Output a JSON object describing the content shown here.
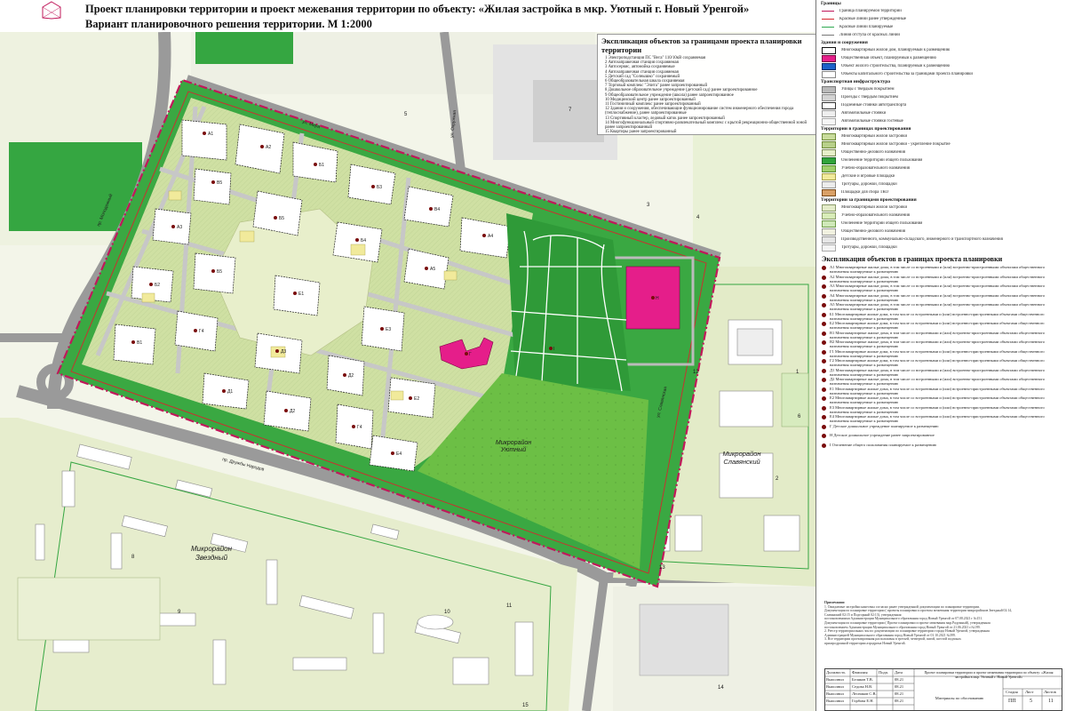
{
  "header": {
    "title_line1": "Проект планировки территории и проект межевания территории по объекту:  «Жилая застройка в мкр. Уютный г. Новый Уренгой»",
    "title_line2": "Вариант планировочного решения территории. М 1:2000"
  },
  "map": {
    "district_labels": {
      "uyutny": "Микрорайон\nУютный",
      "zvezdny": "Микрорайон\nЗвездный",
      "slavyansky": "Микрорайон\nСлавянский"
    },
    "street_labels": {
      "mira": "ул. Мира",
      "druzhby": "пр. Дружбы Народов",
      "stepan": "пр. Молодежный",
      "okruzhnaya": "ул. Окружная",
      "slavyanskaya": "ул. Славянская"
    },
    "building_codes": [
      "А1",
      "А2",
      "А3",
      "А4",
      "А5",
      "Б1",
      "Б2",
      "Б3",
      "Б4",
      "Б5",
      "В1",
      "В2",
      "В3",
      "В4",
      "В5",
      "Г1",
      "Г2",
      "Г3",
      "Г4",
      "Г5",
      "Д1",
      "Д2",
      "Д3",
      "Д4",
      "Е1",
      "Е2",
      "Е3",
      "Е4"
    ],
    "site_numbers": [
      "1",
      "2",
      "3",
      "4",
      "5",
      "6",
      "7",
      "8",
      "9",
      "10",
      "11",
      "12",
      "13",
      "14",
      "15"
    ]
  },
  "explication_outside": {
    "title": "Экспликация объектов за границами проекта планировки территории",
    "items": [
      "1 Электроподстанция ПС \"Вега\" 110/10кВ сохраняемая",
      "2 Автозаправочная станция сохраняемая",
      "3 Автосервис, автомойка сохраняемые",
      "4 Автозаправочная станция сохраняемая",
      "5 Детский сад \"Солнышко\" сохраняемый",
      "6 Общеобразовательная школа сохраняемая",
      "7 Торговый комплекс \"Элита\" ранее запроектированный",
      "8 Дошкольное образовательное учреждение (детский сад) ранее запроектированное",
      "9 Общеобразовательное учреждение (школа) ранее запроектированное",
      "10 Медицинский центр ранее запроектированный",
      "11 Гостиничный комплекс ранее запроектированный",
      "12 Здания и сооружения, обеспечивающие функционирование систем инженерного обеспечения города (теплоснабжение), ранее запроектированные",
      "13 Спортивный кластер, ледовый каток ранее запроектированный",
      "14 Многофункциональный спортивно-развлекательный комплекс с крытой рекреационно-общественной зоной ранее запроектированный",
      "15 Квартиры ранее запроектированный"
    ]
  },
  "legend": {
    "sections": [
      {
        "title": "Границы",
        "rows": [
          {
            "label": "Граница планируемой территории",
            "color": "#ffffff",
            "border": "#c0185a"
          },
          {
            "label": "Красные линии ранее утвержденные",
            "color": "#ffffff",
            "border": "#d6262e"
          },
          {
            "label": "Красные линии планируемые",
            "color": "#ffffff",
            "border": "#2fa84f"
          },
          {
            "label": "Линия отступа от красных линий",
            "color": "#ffffff",
            "border": "#777777"
          }
        ]
      },
      {
        "title": "Здания и сооружения",
        "rows": [
          {
            "label": "Многоквартирный жилой дом, планируемый к размещению",
            "color": "#ffffff",
            "border": "#111111"
          },
          {
            "label": "Общественный объект, планируемый к размещению",
            "color": "#e51e8a",
            "border": "#7a0040"
          },
          {
            "label": "Объект жилого строительства, планируемый к размещению",
            "color": "#1e62c9",
            "border": "#0a2a66"
          },
          {
            "label": "Объекты капитального строительства за границами проекта планировки",
            "color": "#ffffff",
            "border": "#888888"
          }
        ]
      },
      {
        "title": "Транспортная инфраструктура",
        "rows": [
          {
            "label": "Улицы с твердым покрытием",
            "color": "#b9b9b9",
            "border": "#777777"
          },
          {
            "label": "Проезды с твердым покрытием",
            "color": "#d3d3d3",
            "border": "#888888"
          },
          {
            "label": "Подземные стоянки автотранспорта",
            "color": "#ffffff",
            "border": "#333333"
          },
          {
            "label": "Автомобильные стоянки",
            "color": "#eeeeee",
            "border": "#999999"
          },
          {
            "label": "Автомобильные стоянки гостевые",
            "color": "#f6f6f6",
            "border": "#aaaaaa"
          }
        ]
      },
      {
        "title": "Территории в границах проектирования",
        "rows": [
          {
            "label": "Многоквартирный жилой застройки",
            "color": "#c9dc9c",
            "border": "#6e8a3a"
          },
          {
            "label": "Многоквартирный жилой застройки - укрепление покрытие",
            "color": "#b8d08a",
            "border": "#6e8a3a"
          },
          {
            "label": "Общественно-делового назначения",
            "color": "#e7efc9",
            "border": "#7e8a5a"
          },
          {
            "label": "Озеленение территорий общего пользования",
            "color": "#2fa33a",
            "border": "#1f6a25"
          },
          {
            "label": "Учебно-образовательного назначения",
            "color": "#9fcf6b",
            "border": "#5a8a33"
          },
          {
            "label": "Детские и игровые площадки",
            "color": "#f1ea9b",
            "border": "#a7a04a"
          },
          {
            "label": "Тротуары, дорожки, площадки",
            "color": "#ececec",
            "border": "#999999"
          },
          {
            "label": "Площадки для сбора ТКО",
            "color": "#d9a066",
            "border": "#7a4a1a"
          }
        ]
      },
      {
        "title": "Территории за границами проектирования",
        "rows": [
          {
            "label": "Многоквартирный жилой застройки",
            "color": "#e4ecc9",
            "border": "#8a9a6a"
          },
          {
            "label": "Учебно-образовательного назначения",
            "color": "#d8ecb8",
            "border": "#8a9a6a"
          },
          {
            "label": "Озеленение территорий общего пользования",
            "color": "#cfe8b8",
            "border": "#6f9a4a"
          },
          {
            "label": "Общественно-делового назначения",
            "color": "#f1f1e0",
            "border": "#999999"
          },
          {
            "label": "Производственного, коммунально-складского, инженерного и транспортного назначения",
            "color": "#e6e6e6",
            "border": "#999999"
          },
          {
            "label": "Тротуары, дорожки, площадки",
            "color": "#f4f4f4",
            "border": "#aaaaaa"
          }
        ]
      }
    ]
  },
  "explication_inside": {
    "title": "Экспликация объектов в границах проекта планировки",
    "items": [
      "А1 Многоквартирные жилые дома, в том числе со встроенными и (или) встроенно-пристроенными объектами общественного назначения планируемые к размещению",
      "А2 Многоквартирные жилые дома, в том числе со встроенными и (или) встроенно-пристроенными объектами общественного назначения планируемые к размещению",
      "А3 Многоквартирные жилые дома, в том числе со встроенными и (или) встроенно-пристроенными объектами общественного назначения планируемые к размещению",
      "А4 Многоквартирные жилые дома, в том числе со встроенными и (или) встроенно-пристроенными объектами общественного назначения планируемые к размещению",
      "А5 Многоквартирные жилые дома, в том числе со встроенными и (или) встроенно-пристроенными объектами общественного назначения планируемые к размещению",
      "Б1 Многоквартирные жилые дома, в том числе со встроенными и (или) встроенно-пристроенными объектами общественного назначения планируемые к размещению",
      "Б2 Многоквартирные жилые дома, в том числе со встроенными и (или) встроенно-пристроенными объектами общественного назначения планируемые к размещению",
      "В1 Многоквартирные жилые дома, в том числе со встроенными и (или) встроенно-пристроенными объектами общественного назначения планируемые к размещению",
      "В2 Многоквартирные жилые дома, в том числе со встроенными и (или) встроенно-пристроенными объектами общественного назначения планируемые к размещению",
      "Г1 Многоквартирные жилые дома, в том числе со встроенными и (или) встроенно-пристроенными объектами общественного назначения планируемые к размещению",
      "Г2 Многоквартирные жилые дома, в том числе со встроенными и (или) встроенно-пристроенными объектами общественного назначения планируемые к размещению",
      "Д1 Многоквартирные жилые дома, в том числе со встроенными и (или) встроенно-пристроенными объектами общественного назначения планируемые к размещению",
      "Д2 Многоквартирные жилые дома, в том числе со встроенными и (или) встроенно-пристроенными объектами общественного назначения планируемые к размещению",
      "Е1 Многоквартирные жилые дома, в том числе со встроенными и (или) встроенно-пристроенными объектами общественного назначения планируемые к размещению",
      "Е2 Многоквартирные жилые дома, в том числе со встроенными и (или) встроенно-пристроенными объектами общественного назначения планируемые к размещению",
      "Е3 Многоквартирные жилые дома, в том числе со встроенными и (или) встроенно-пристроенными объектами общественного назначения планируемые к размещению",
      "Е4 Многоквартирные жилые дома, в том числе со встроенными и (или) встроенно-пристроенными объектами общественного назначения планируемые к размещению",
      "Г Детское дошкольное учреждение планируемое к размещению",
      "Н Детское дошкольное учреждение ранее запроектированное",
      "I Озеленение общего пользования планируемое к размещению"
    ]
  },
  "notes": {
    "title": "Примечания:",
    "lines": [
      "1. Ожидаемые застройки нанесены согласно ранее утвержденной документации по планировке территории.",
      "Документация по планировке территории ( проекты планировки и проекты межевания территории микрорайонов Звездный 02:14,",
      "Славянский 02:15 и Подгорный 02:13), утвержденная",
      "постановлениями Администрации Муниципального образования город Новый Уренгой от 07.08.2021 г №151.",
      "Документация по планировке территории ( Проект планировки и проект межевания мкр.Радужный), утвержденная",
      "постановлением Администрации Муниципального образования город Новый Уренгой от 21.06.2021 г.№199.",
      "2. Реестр территориальных зон по документации по планировке территории города Новый Уренгой, утвержденная",
      "Администрацией Муниципального образования город Новый Уренгой от 01.10.2021 №399.",
      "3. Все территории проектирования расположены в третьей, четвертой, пятой, шестой подзонах",
      "приаэродромной территории аэродрома Новый Уренгой."
    ]
  },
  "stamp": {
    "project_title": "Проект планировки территории и проект межевания территории по объекту: «Жилая застройка в мкр. Уютный г. Новый Уренгой»",
    "subtitle": "Материалы по обоснованию",
    "cells": [
      "Должность",
      "Фамилия",
      "Подп.",
      "Дата",
      "Стадия",
      "Лист",
      "Листов",
      "ПП",
      "5",
      "11"
    ],
    "rows": [
      "Выполнил",
      "Выполнил",
      "Выполнил",
      "Выполнил"
    ],
    "names": [
      "Беляков Т.В.",
      "Седова Н.В.",
      "Лесников С.В.",
      "Горбова Е.Н."
    ],
    "dates": [
      "08.21",
      "08.21",
      "08.21",
      "08.21"
    ]
  }
}
